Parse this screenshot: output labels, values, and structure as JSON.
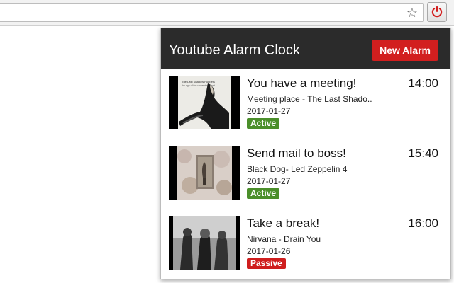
{
  "browser": {
    "bookmark_icon": "star-icon",
    "extension_icon": "power-icon"
  },
  "popup": {
    "title": "Youtube Alarm Clock",
    "new_alarm_label": "New Alarm",
    "colors": {
      "header_bg": "#2b2b2b",
      "accent": "#d21f1f",
      "active_badge": "#4b8f2b",
      "passive_badge": "#cf1e1e"
    }
  },
  "alarms": [
    {
      "title": "You have a meeting!",
      "time": "14:00",
      "song": "Meeting place - The Last Shado..",
      "date": "2017-01-27",
      "status": "Active"
    },
    {
      "title": "Send mail to boss!",
      "time": "15:40",
      "song": "Black Dog- Led Zeppelin 4",
      "date": "2017-01-27",
      "status": "Active"
    },
    {
      "title": "Take a break!",
      "time": "16:00",
      "song": "Nirvana - Drain You",
      "date": "2017-01-26",
      "status": "Passive"
    }
  ]
}
